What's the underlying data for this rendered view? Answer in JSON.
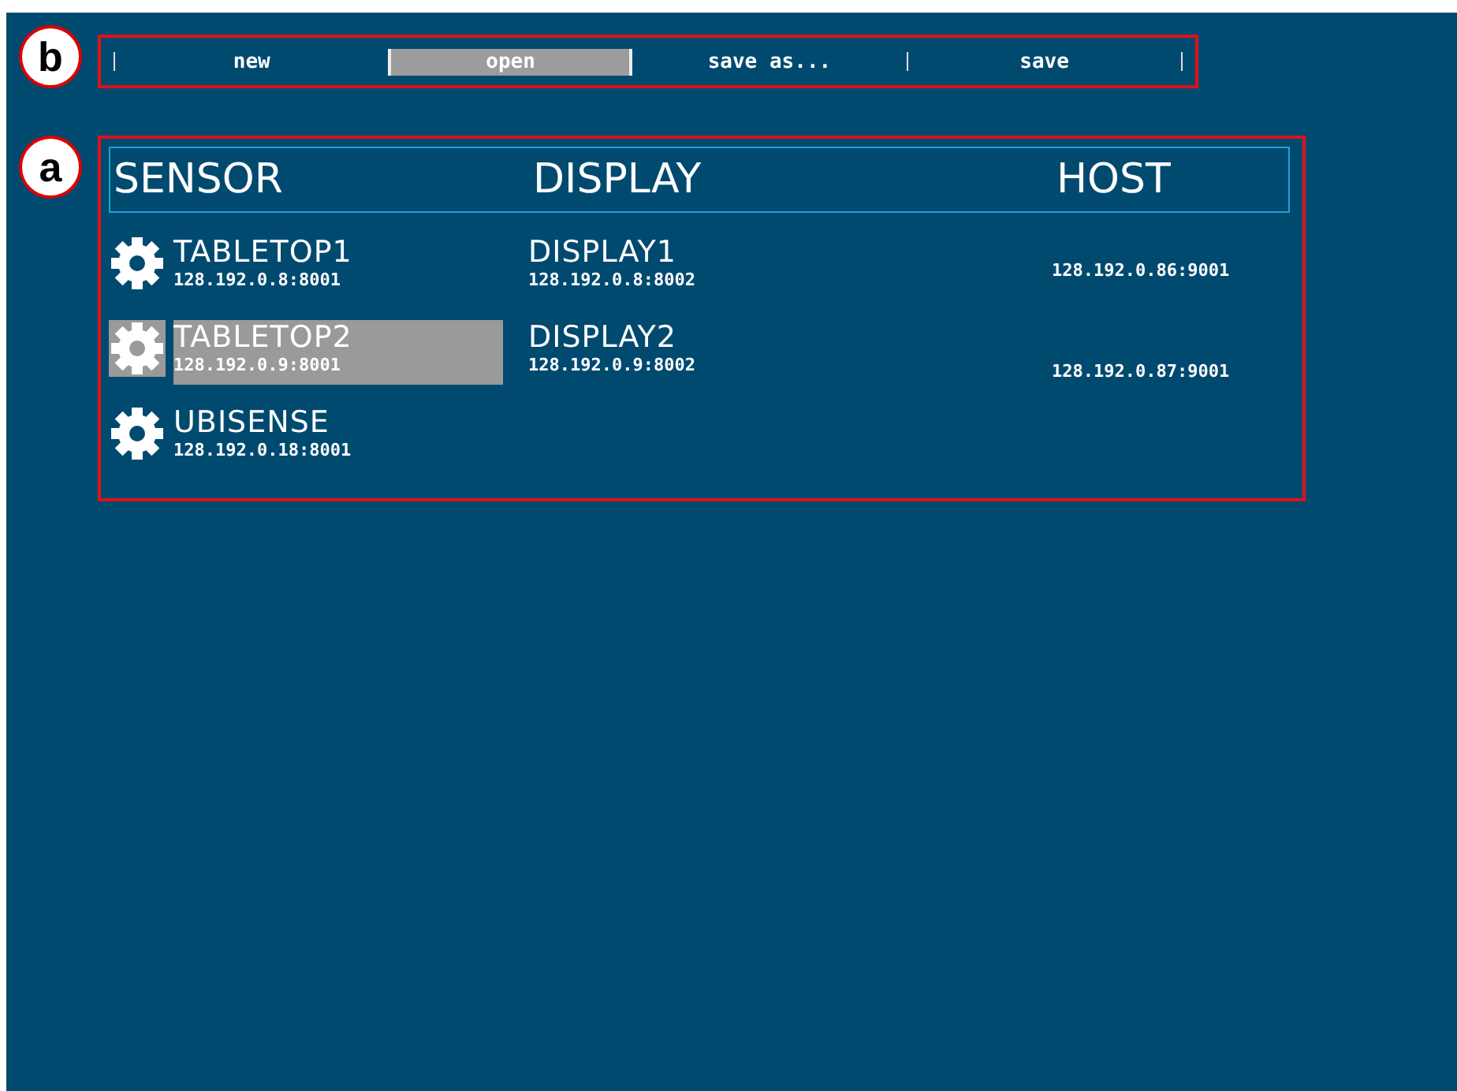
{
  "callouts": [
    {
      "label": "b"
    },
    {
      "label": "a"
    }
  ],
  "toolbar": {
    "buttons": [
      {
        "label": "new",
        "selected": false
      },
      {
        "label": "open",
        "selected": true
      },
      {
        "label": "save as...",
        "selected": false
      },
      {
        "label": "save",
        "selected": false
      }
    ]
  },
  "table": {
    "columns": [
      "SENSOR",
      "DISPLAY",
      "HOST"
    ],
    "rows": [
      {
        "sensor": {
          "name": "TABLETOP1",
          "address": "128.192.0.8:8001",
          "selected": false
        },
        "display": {
          "name": "DISPLAY1",
          "address": "128.192.0.8:8002"
        },
        "host": {
          "address": "128.192.0.86:9001"
        }
      },
      {
        "sensor": {
          "name": "TABLETOP2",
          "address": "128.192.0.9:8001",
          "selected": true
        },
        "display": {
          "name": "DISPLAY2",
          "address": "128.192.0.9:8002"
        },
        "host": {
          "address": "128.192.0.87:9001"
        }
      },
      {
        "sensor": {
          "name": "UBISENSE",
          "address": "128.192.0.18:8001",
          "selected": false
        }
      }
    ]
  }
}
